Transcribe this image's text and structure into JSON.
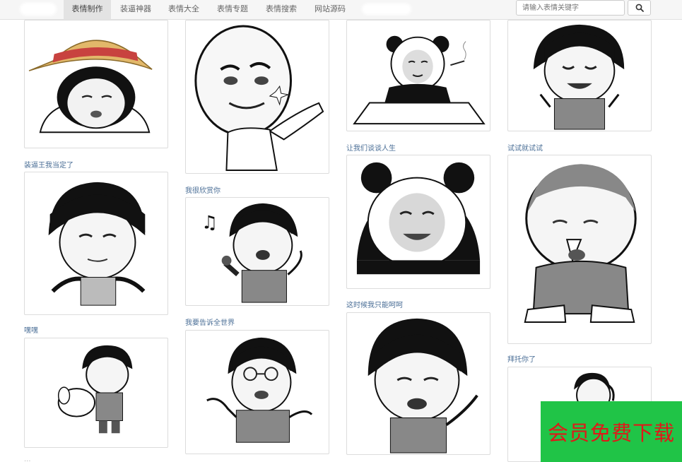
{
  "nav": {
    "items": [
      {
        "label": "表情制作",
        "active": true
      },
      {
        "label": "装逼神器",
        "active": false
      },
      {
        "label": "表情大全",
        "active": false
      },
      {
        "label": "表情专题",
        "active": false
      },
      {
        "label": "表情搜索",
        "active": false
      },
      {
        "label": "网站源码",
        "active": false
      }
    ],
    "search": {
      "placeholder": "请输入表情关键字",
      "icon": "search-icon"
    }
  },
  "grid": {
    "captions": {
      "c1": "装逼王我当定了",
      "c2": "嘿嘿",
      "c3": "我很欣赏你",
      "c4": "我要告诉全世界",
      "c5": "让我们谈谈人生",
      "c6": "这时候我只能呵呵",
      "c7": "试试就试试",
      "c8": "拜托你了"
    }
  },
  "promo": {
    "label": "会员免费下载",
    "background": "#20c447",
    "text_color": "#e01818"
  },
  "colors": {
    "caption": "#4a6e96",
    "border": "#dcdcdc"
  }
}
